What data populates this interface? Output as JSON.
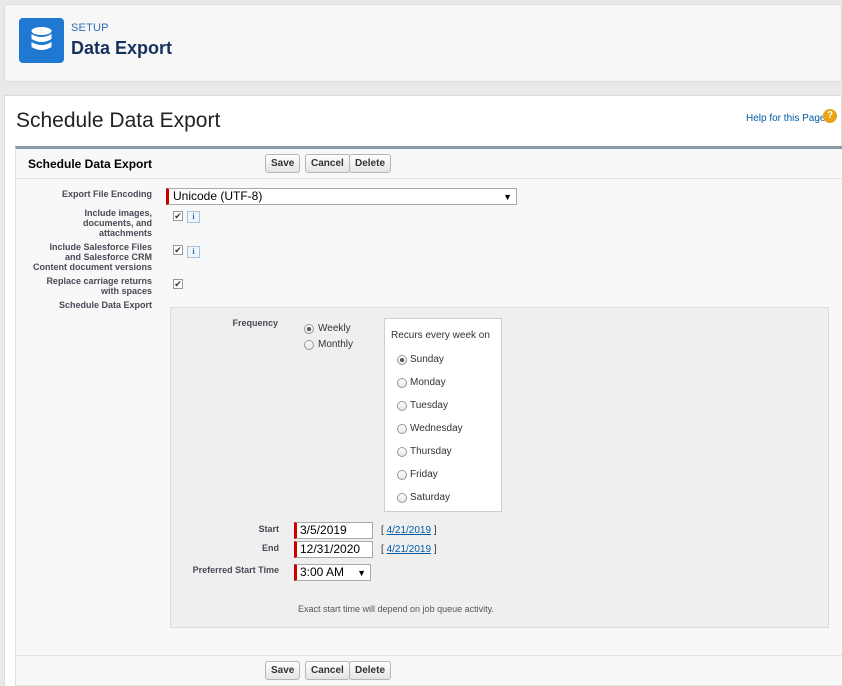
{
  "setup_header": {
    "eyebrow": "SETUP",
    "title": "Data Export",
    "icon": "database-icon"
  },
  "page": {
    "title": "Schedule Data Export",
    "help_link": "Help for this Page",
    "help_icon": "?"
  },
  "block": {
    "title": "Schedule Data Export",
    "buttons": {
      "save": "Save",
      "cancel": "Cancel",
      "delete": "Delete"
    }
  },
  "fields": {
    "encoding": {
      "label": "Export File Encoding",
      "value": "Unicode (UTF-8)"
    },
    "include_images": {
      "label_lines": [
        "Include images,",
        "documents, and",
        "attachments"
      ],
      "checked": true
    },
    "include_files": {
      "label_lines": [
        "Include Salesforce Files",
        "and Salesforce CRM",
        "Content document versions"
      ],
      "checked": true
    },
    "replace_cr": {
      "label_lines": [
        "Replace carriage returns",
        "with spaces"
      ],
      "checked": true
    },
    "schedule_label": "Schedule Data Export",
    "info_glyph": "i",
    "check_glyph": "✔"
  },
  "schedule": {
    "frequency_label": "Frequency",
    "frequency_options": [
      {
        "label": "Weekly",
        "selected": true
      },
      {
        "label": "Monthly",
        "selected": false
      }
    ],
    "recurs_label": "Recurs every week on",
    "days": [
      {
        "label": "Sunday",
        "selected": true
      },
      {
        "label": "Monday",
        "selected": false
      },
      {
        "label": "Tuesday",
        "selected": false
      },
      {
        "label": "Wednesday",
        "selected": false
      },
      {
        "label": "Thursday",
        "selected": false
      },
      {
        "label": "Friday",
        "selected": false
      },
      {
        "label": "Saturday",
        "selected": false
      }
    ],
    "start": {
      "label": "Start",
      "value": "3/5/2019",
      "today_link": "4/21/2019"
    },
    "end": {
      "label": "End",
      "value": "12/31/2020",
      "today_link": "4/21/2019"
    },
    "preferred_time": {
      "label": "Preferred Start Time",
      "value": "3:00 AM"
    },
    "note": "Exact start time will depend on job queue activity."
  },
  "colors": {
    "brand": "#1f78d1",
    "required": "#cc0000",
    "link": "#015ba7"
  }
}
